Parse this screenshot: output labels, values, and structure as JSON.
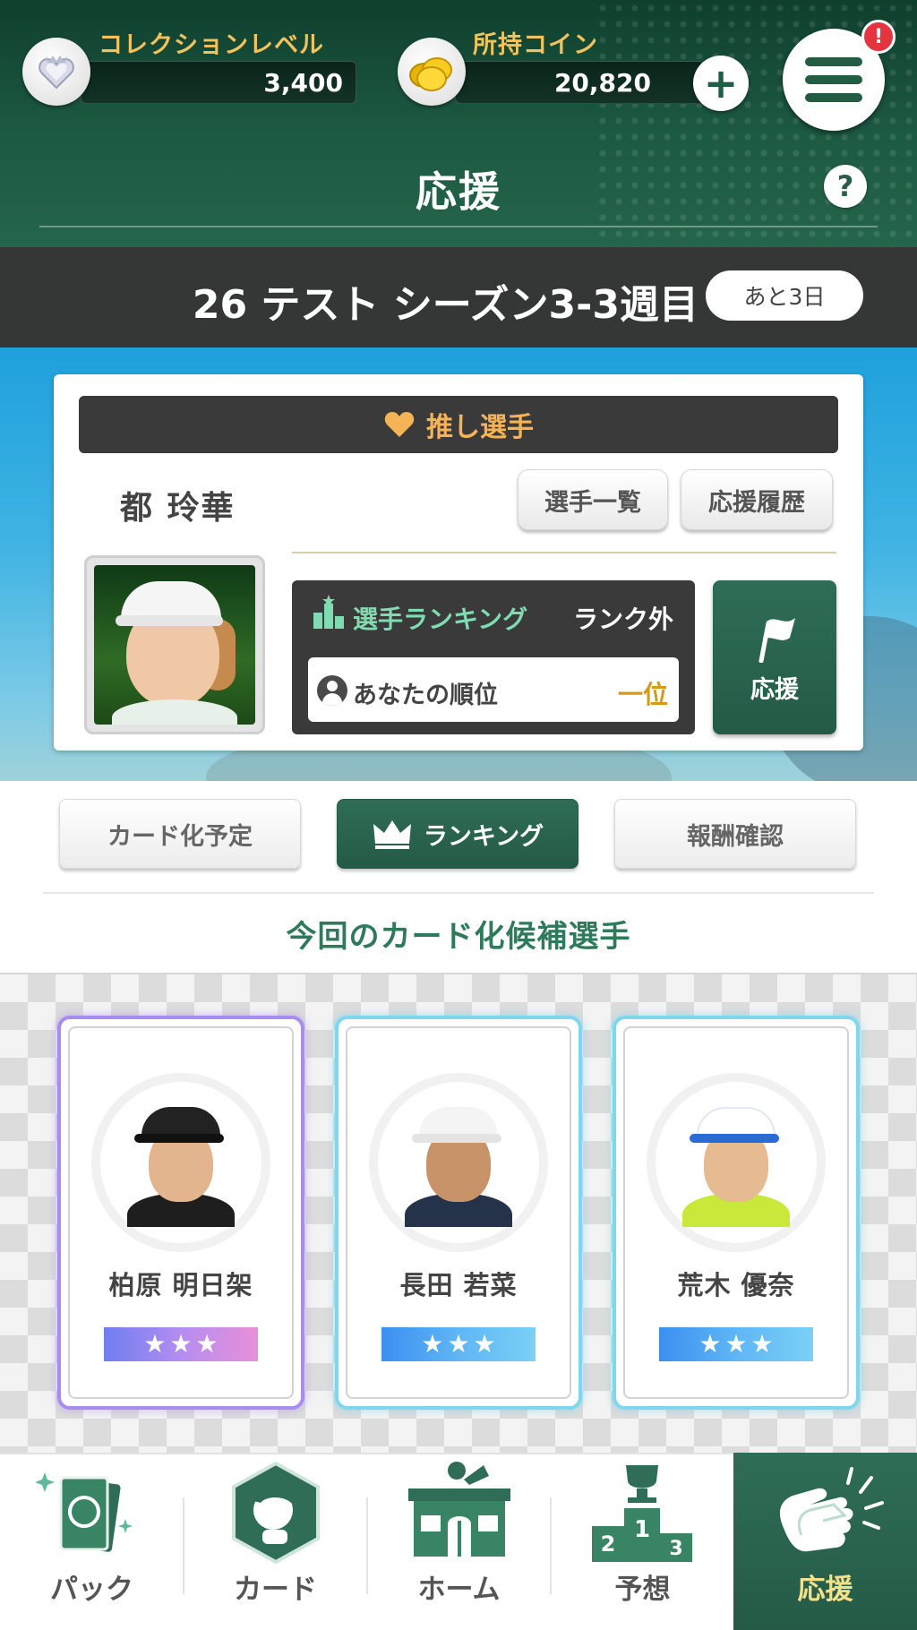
{
  "header": {
    "collection_level_label": "コレクションレベル",
    "collection_level_value": "3,400",
    "coins_label": "所持コイン",
    "coins_value": "20,820",
    "plus_symbol": "+",
    "notification_badge": "!",
    "page_title": "応援",
    "help_symbol": "?"
  },
  "season": {
    "title": "26 テスト シーズン3-3週目",
    "days_left": "あと3日"
  },
  "oshi": {
    "header_label": "推し選手",
    "player_name": "都 玲華",
    "player_list_button": "選手一覧",
    "support_history_button": "応援履歴",
    "ranking_label": "選手ランキング",
    "ranking_value": "ランク外",
    "your_rank_label": "あなたの順位",
    "your_rank_value": "一位",
    "support_button": "応援"
  },
  "tabs": [
    {
      "label": "カード化予定",
      "active": false
    },
    {
      "label": "ランキング",
      "active": true
    },
    {
      "label": "報酬確認",
      "active": false
    }
  ],
  "candidates_title": "今回のカード化候補選手",
  "candidates": [
    {
      "name": "柏原 明日架",
      "stars": 3,
      "frame": "purple"
    },
    {
      "name": "長田 若菜",
      "stars": 3,
      "frame": "cyan"
    },
    {
      "name": "荒木 優奈",
      "stars": 3,
      "frame": "cyan"
    }
  ],
  "star_glyph": "★",
  "bottom_nav": [
    {
      "label": "パック",
      "icon": "pack-icon",
      "active": false
    },
    {
      "label": "カード",
      "icon": "card-icon",
      "active": false
    },
    {
      "label": "ホーム",
      "icon": "home-icon",
      "active": false
    },
    {
      "label": "予想",
      "icon": "podium-icon",
      "active": false
    },
    {
      "label": "応援",
      "icon": "clapping-hands-icon",
      "active": true
    }
  ],
  "colors": {
    "header_green": "#1d5a42",
    "accent_green": "#2f6d56",
    "gold": "#f2c35c",
    "season_bar": "#353737",
    "notification_red": "#e5333f"
  }
}
